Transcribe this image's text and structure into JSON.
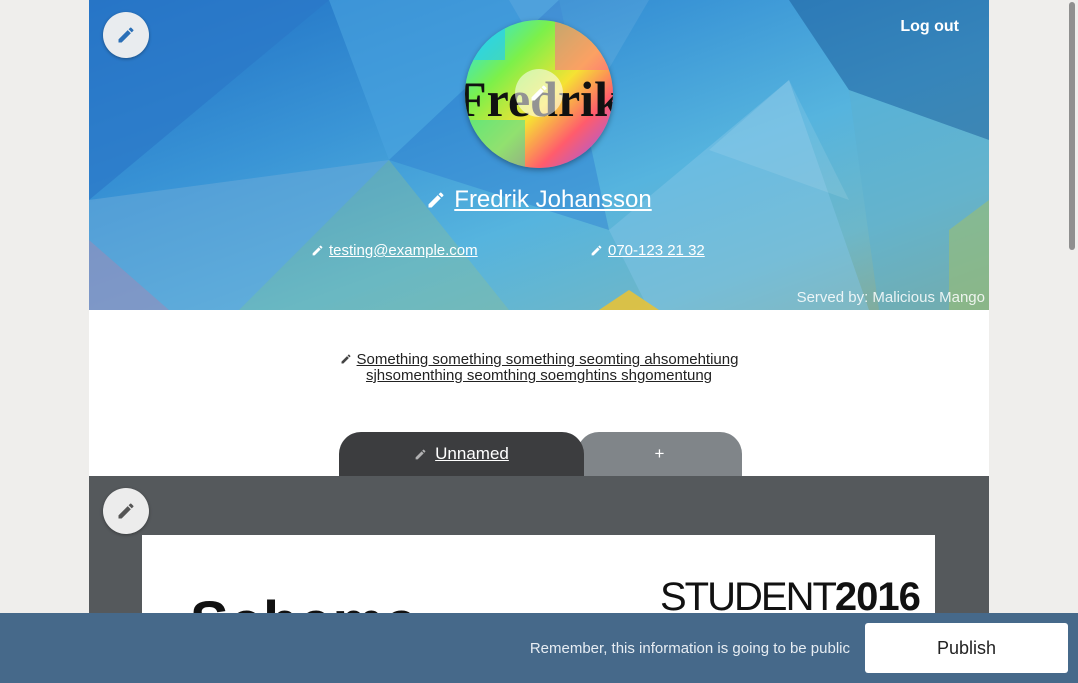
{
  "header": {
    "logout_label": "Log out",
    "name": "Fredrik Johansson",
    "email": "testing@example.com",
    "phone": "070-123 21 32",
    "served_by": "Served by: Malicious Mango",
    "avatar_text": "Fredrik"
  },
  "bio": {
    "line1": "Something something something seomting ahsomehtiung",
    "line2": "sjhsomenthing seomthing soemghtins shgomentung"
  },
  "tabs": {
    "active_label": "Unnamed",
    "add_label": "+"
  },
  "document": {
    "title_fragment": "Schema",
    "logo_part1": "STUDENT",
    "logo_part2": "2016"
  },
  "bottom_bar": {
    "notice": "Remember, this information is going to be public",
    "publish_label": "Publish"
  },
  "colors": {
    "accent_blue": "#3a95d6",
    "bottom_bar": "#46698a",
    "tab_active": "#3c3d3f",
    "tab_inactive": "#808589",
    "content_bg": "#55595c"
  },
  "icons": {
    "edit": "pencil-icon"
  }
}
